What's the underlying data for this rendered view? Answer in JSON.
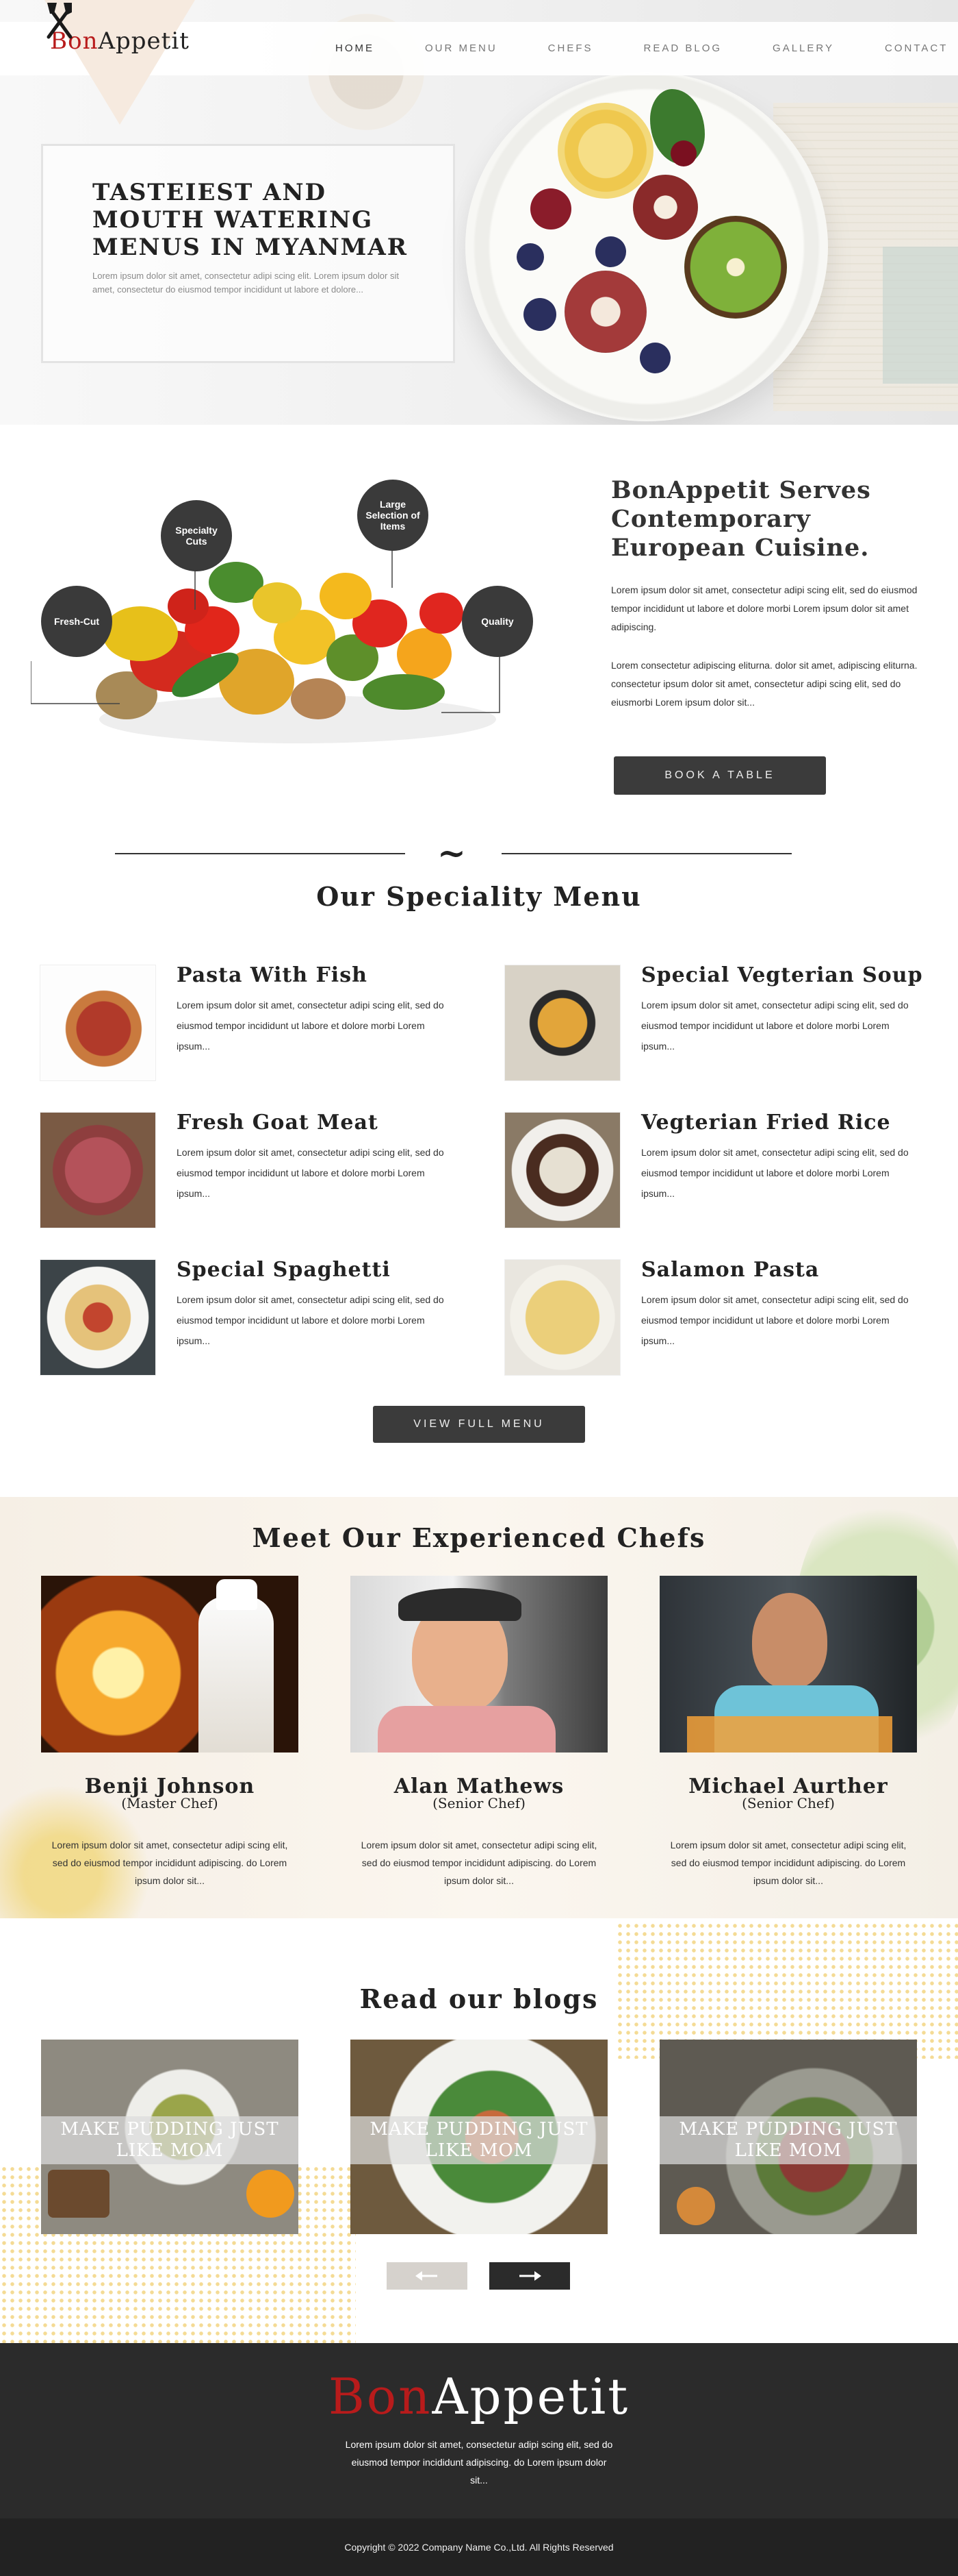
{
  "brand": {
    "logo_part1": "Bon",
    "logo_part2": "Appetit",
    "accent": "#b81b1b"
  },
  "nav": {
    "items": [
      {
        "label": "HOME"
      },
      {
        "label": "OUR MENU"
      },
      {
        "label": "CHEFS"
      },
      {
        "label": "READ BLOG"
      },
      {
        "label": "GALLERY"
      },
      {
        "label": "CONTACT"
      }
    ]
  },
  "hero": {
    "title": "Tasteiest and mouth watering menus in Myanmar",
    "subtitle": "Lorem ipsum dolor sit amet, consectetur adipi scing elit. Lorem ipsum dolor sit amet, consectetur do eiusmod tempor incididunt ut labore et dolore..."
  },
  "intro": {
    "heading": "BonAppetit Serves Contemporary European Cuisine.",
    "paragraph1": "Lorem ipsum dolor sit amet, consectetur adipi scing elit, sed do eiusmod tempor incididunt ut labore et dolore morbi Lorem ipsum dolor sit amet adipiscing.",
    "paragraph2": "Lorem consectetur adipiscing eliturna. dolor sit amet, adipiscing eliturna. consectetur ipsum dolor sit amet, consectetur adipi scing elit, sed do eiusmorbi Lorem ipsum dolor sit...",
    "button": "Book a table",
    "bubbles": [
      "Fresh-Cut",
      "Specialty Cuts",
      "Large Selection of Items",
      "Quality"
    ]
  },
  "menu": {
    "title": "Our Speciality Menu",
    "items": [
      {
        "name": "Pasta With Fish",
        "desc": "Lorem ipsum dolor sit amet, consectetur adipi scing elit, sed do eiusmod tempor incididunt ut labore et dolore morbi Lorem ipsum..."
      },
      {
        "name": "Special Vegterian Soup",
        "desc": "Lorem ipsum dolor sit amet, consectetur adipi scing elit, sed do eiusmod tempor incididunt ut labore et dolore morbi Lorem ipsum..."
      },
      {
        "name": "Fresh Goat Meat",
        "desc": "Lorem ipsum dolor sit amet, consectetur adipi scing elit, sed do eiusmod tempor incididunt ut labore et dolore morbi Lorem ipsum..."
      },
      {
        "name": "Vegterian Fried Rice",
        "desc": "Lorem ipsum dolor sit amet, consectetur adipi scing elit, sed do eiusmod tempor incididunt ut labore et dolore morbi Lorem ipsum..."
      },
      {
        "name": "Special Spaghetti",
        "desc": "Lorem ipsum dolor sit amet, consectetur adipi scing elit, sed do eiusmod tempor incididunt ut labore et dolore morbi Lorem ipsum..."
      },
      {
        "name": "Salamon Pasta",
        "desc": "Lorem ipsum dolor sit amet, consectetur adipi scing elit, sed do eiusmod tempor incididunt ut labore et dolore morbi Lorem ipsum..."
      }
    ],
    "button": "View full menu"
  },
  "chefs": {
    "title": "Meet Our Experienced Chefs",
    "items": [
      {
        "name": "Benji Johnson",
        "role": "(Master Chef)",
        "desc": "Lorem ipsum dolor sit amet, consectetur adipi scing elit, sed do eiusmod tempor incididunt adipiscing. do Lorem ipsum dolor sit..."
      },
      {
        "name": "Alan Mathews",
        "role": "(Senior Chef)",
        "desc": "Lorem ipsum dolor sit amet, consectetur adipi scing elit, sed do eiusmod tempor incididunt adipiscing. do Lorem ipsum dolor sit..."
      },
      {
        "name": "Michael Aurther",
        "role": "(Senior Chef)",
        "desc": "Lorem ipsum dolor sit amet, consectetur adipi scing elit, sed do eiusmod tempor incididunt adipiscing. do Lorem ipsum dolor sit..."
      }
    ]
  },
  "blogs": {
    "title": "Read our blogs",
    "items": [
      {
        "title": "Make pudding just like mom"
      },
      {
        "title": "Make pudding just like mom"
      },
      {
        "title": "Make pudding just like mom"
      }
    ],
    "prev_icon": "arrow-left-icon",
    "next_icon": "arrow-right-icon"
  },
  "footer": {
    "logo_part1": "Bon",
    "logo_part2": "Appetit",
    "text": "Lorem ipsum dolor sit amet, consectetur adipi scing elit, sed do eiusmod tempor incididunt adipiscing. do Lorem ipsum dolor sit...",
    "copyright": "Copyright © 2022 Company Name Co.,Ltd. All Rights Reserved"
  }
}
